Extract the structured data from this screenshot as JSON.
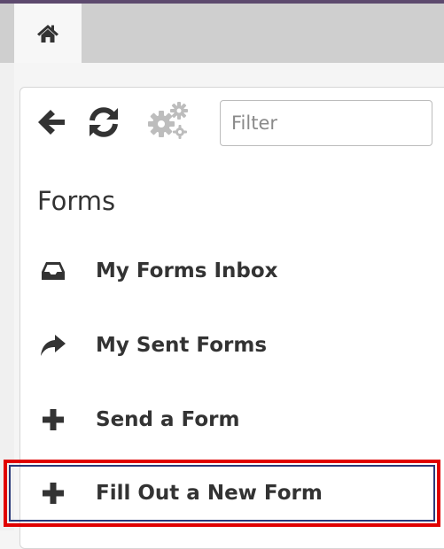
{
  "colors": {
    "top_border": "#5d4a6e",
    "tab_bar": "#cfcfcf",
    "icon_dark": "#333333",
    "icon_disabled": "#bdbdbd",
    "highlight_red": "#e00000",
    "highlight_blue": "#2a3a7a"
  },
  "toolbar": {
    "back_icon": "arrow-left-icon",
    "refresh_icon": "refresh-icon",
    "settings_icon": "cogs-icon",
    "filter_placeholder": "Filter",
    "filter_value": ""
  },
  "section": {
    "title": "Forms"
  },
  "menu": {
    "items": [
      {
        "label": "My Forms Inbox",
        "icon": "inbox-icon"
      },
      {
        "label": "My Sent Forms",
        "icon": "share-arrow-icon"
      },
      {
        "label": "Send a Form",
        "icon": "plus-icon"
      },
      {
        "label": "Fill Out a New Form",
        "icon": "plus-icon",
        "highlighted": true
      }
    ]
  }
}
